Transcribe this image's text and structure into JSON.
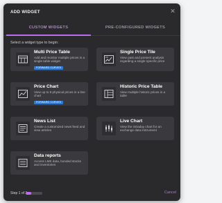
{
  "modal": {
    "title": "ADD WIDGET",
    "close_icon": "close-icon"
  },
  "tabs": [
    {
      "label": "CUSTOM WIDGETS",
      "active": true
    },
    {
      "label": "PRE-CONFIGURED WIDGETS",
      "active": false
    }
  ],
  "prompt": "Select a widget type to begin:",
  "widgets": [
    {
      "title": "Multi Price Table",
      "description": "Add and monitor multiple prices in a single table widget",
      "badge": "FORWARD CURVES",
      "icon": "table-grid-icon"
    },
    {
      "title": "Single Price Tile",
      "description": "View past and present analysis regarding a single specific price",
      "badge": "",
      "icon": "price-tile-icon"
    },
    {
      "title": "Price Chart",
      "description": "View up to 8 physical prices in a line chart",
      "badge": "FORWARD CURVES",
      "icon": "line-chart-icon"
    },
    {
      "title": "Historic Price Table",
      "description": "View multiple historic prices in a table",
      "badge": "",
      "icon": "historic-table-icon"
    },
    {
      "title": "News List",
      "description": "Create a customized news feed and view articles",
      "badge": "",
      "icon": "news-list-icon"
    },
    {
      "title": "Live Chart",
      "description": "View the intraday chart for an exchange data instrument",
      "badge": "",
      "icon": "candlestick-icon"
    },
    {
      "title": "Data reports",
      "description": "Access LME data, bonded stocks and inventories",
      "badge": "",
      "icon": "report-icon"
    }
  ],
  "footer": {
    "step_text": "Step 1 of 3",
    "progress": 0.33,
    "cancel_label": "Cancel"
  },
  "colors": {
    "accent": "#c06cf0",
    "badge": "#2c7bd6",
    "card": "#3a3a3e",
    "modal": "#2a2a2c"
  }
}
